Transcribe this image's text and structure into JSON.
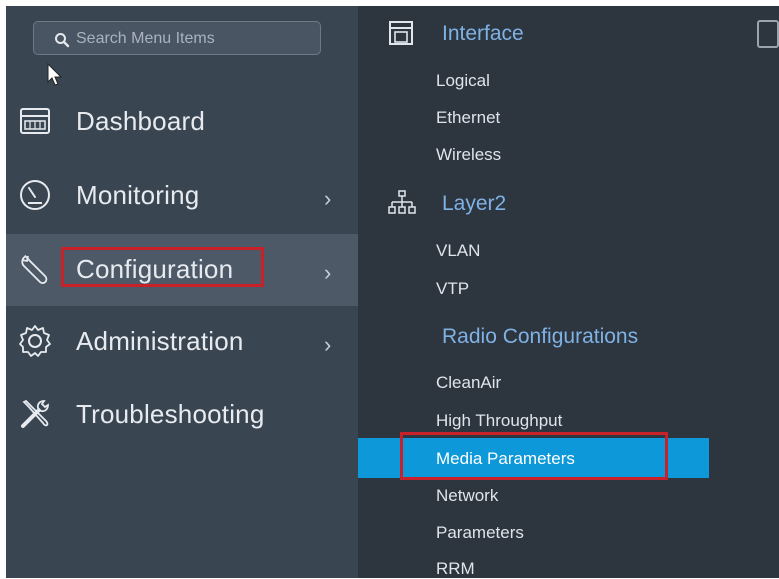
{
  "search": {
    "placeholder": "Search Menu Items",
    "icon": "search-icon"
  },
  "nav": {
    "items": [
      {
        "label": "Dashboard",
        "icon": "dashboard-icon",
        "has_submenu": false
      },
      {
        "label": "Monitoring",
        "icon": "gauge-icon",
        "has_submenu": true,
        "chevron": "›"
      },
      {
        "label": "Configuration",
        "icon": "wrench-icon",
        "has_submenu": true,
        "chevron": "›",
        "active": true
      },
      {
        "label": "Administration",
        "icon": "gear-icon",
        "has_submenu": true,
        "chevron": "›"
      },
      {
        "label": "Troubleshooting",
        "icon": "tools-icon",
        "has_submenu": false
      }
    ]
  },
  "submenu": {
    "sections": [
      {
        "title": "Interface",
        "icon": "interface-icon",
        "items": [
          "Logical",
          "Ethernet",
          "Wireless"
        ]
      },
      {
        "title": "Layer2",
        "icon": "network-tree-icon",
        "items": [
          "VLAN",
          "VTP"
        ]
      },
      {
        "title": "Radio Configurations",
        "icon": "",
        "items": [
          "CleanAir",
          "High Throughput",
          "Media Parameters",
          "Network",
          "Parameters",
          "RRM"
        ]
      }
    ],
    "selected_item": "Media Parameters"
  },
  "colors": {
    "sidebar_bg": "#3a4552",
    "submenu_bg": "#2d353f",
    "section_title": "#7fb2e4",
    "selected_bg": "#0d98da",
    "highlight_border": "#c9212a"
  }
}
